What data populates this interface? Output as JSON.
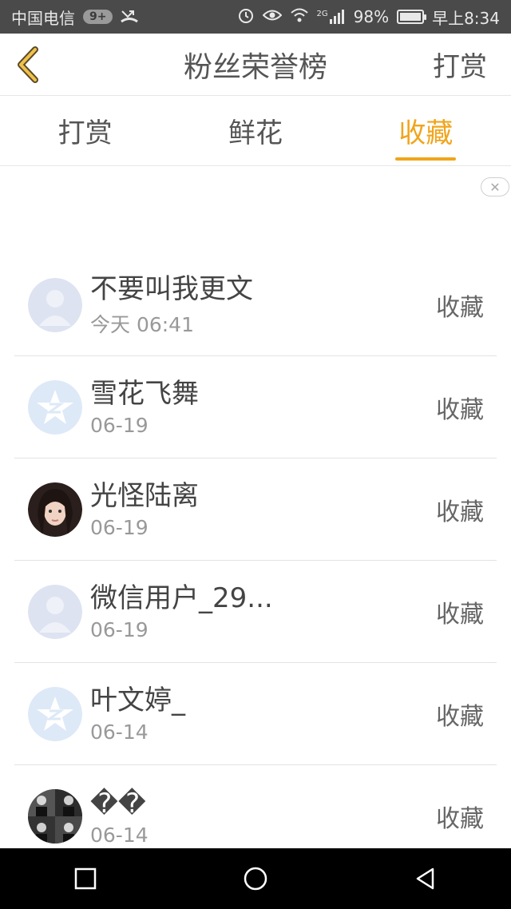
{
  "status": {
    "carrier": "中国电信",
    "notif_badge": "9+",
    "network": "2G",
    "battery": "98%",
    "battery_level": 0.98,
    "time": "早上8:34"
  },
  "header": {
    "title": "粉丝荣誉榜",
    "action": "打赏"
  },
  "tabs": [
    {
      "label": "打赏",
      "active": false
    },
    {
      "label": "鲜花",
      "active": false
    },
    {
      "label": "收藏",
      "active": true
    }
  ],
  "list": [
    {
      "name": "不要叫我更文",
      "time": "今天 06:41",
      "action": "收藏",
      "avatar": "default-person"
    },
    {
      "name": "雪花飞舞",
      "time": "06-19",
      "action": "收藏",
      "avatar": "qq-star"
    },
    {
      "name": "光怪陆离",
      "time": "06-19",
      "action": "收藏",
      "avatar": "photo"
    },
    {
      "name": "微信用户_29...",
      "time": "06-19",
      "action": "收藏",
      "avatar": "default-person"
    },
    {
      "name": "叶文婷_",
      "time": "06-14",
      "action": "收藏",
      "avatar": "qq-star"
    },
    {
      "name": "��",
      "time": "06-14",
      "action": "收藏",
      "avatar": "photo-grid"
    }
  ],
  "colors": {
    "accent": "#f0a51c",
    "status_bar": "#4a4a4a"
  }
}
